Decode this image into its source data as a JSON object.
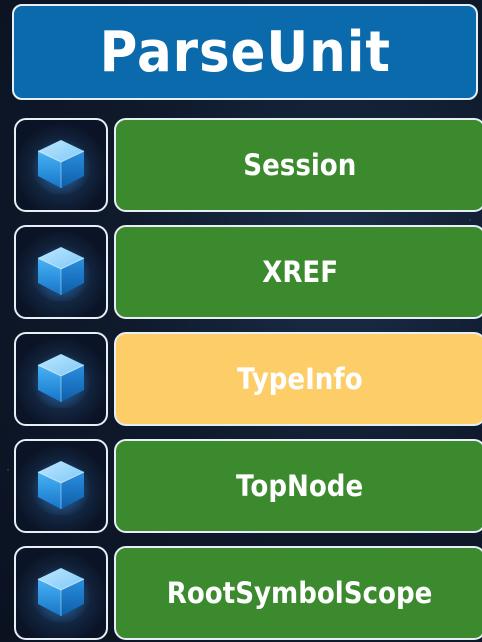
{
  "title": "ParseUnit",
  "colors": {
    "title_bg": "#0a6aab",
    "item_bg": "#3b8a2e",
    "highlight_bg": "#fdcd68",
    "border": "#e8eef6",
    "cube": "#2ea8f5"
  },
  "items": [
    {
      "label": "Session",
      "icon": "cube-icon",
      "highlighted": false
    },
    {
      "label": "XREF",
      "icon": "cube-icon",
      "highlighted": false
    },
    {
      "label": "TypeInfo",
      "icon": "cube-icon",
      "highlighted": true
    },
    {
      "label": "TopNode",
      "icon": "cube-icon",
      "highlighted": false
    },
    {
      "label": "RootSymbolScope",
      "icon": "cube-icon",
      "highlighted": false
    }
  ]
}
